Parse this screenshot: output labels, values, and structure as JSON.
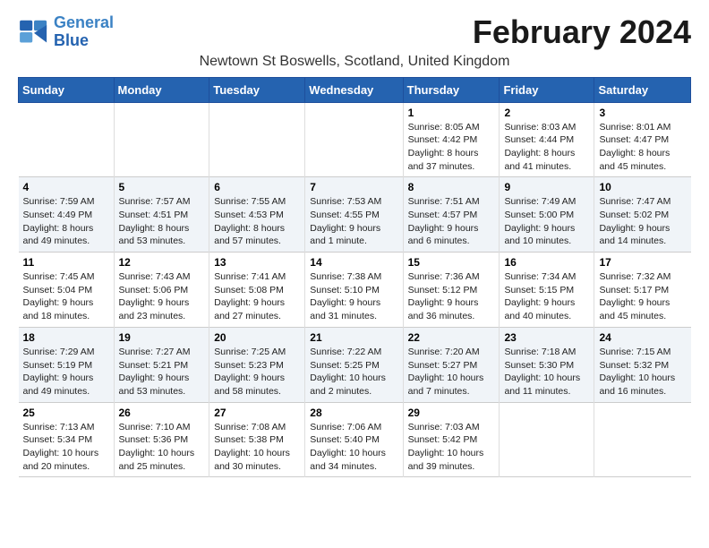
{
  "logo": {
    "line1": "General",
    "line2": "Blue"
  },
  "title": "February 2024",
  "location": "Newtown St Boswells, Scotland, United Kingdom",
  "days_of_week": [
    "Sunday",
    "Monday",
    "Tuesday",
    "Wednesday",
    "Thursday",
    "Friday",
    "Saturday"
  ],
  "weeks": [
    [
      {
        "day": "",
        "info": ""
      },
      {
        "day": "",
        "info": ""
      },
      {
        "day": "",
        "info": ""
      },
      {
        "day": "",
        "info": ""
      },
      {
        "day": "1",
        "info": "Sunrise: 8:05 AM\nSunset: 4:42 PM\nDaylight: 8 hours\nand 37 minutes."
      },
      {
        "day": "2",
        "info": "Sunrise: 8:03 AM\nSunset: 4:44 PM\nDaylight: 8 hours\nand 41 minutes."
      },
      {
        "day": "3",
        "info": "Sunrise: 8:01 AM\nSunset: 4:47 PM\nDaylight: 8 hours\nand 45 minutes."
      }
    ],
    [
      {
        "day": "4",
        "info": "Sunrise: 7:59 AM\nSunset: 4:49 PM\nDaylight: 8 hours\nand 49 minutes."
      },
      {
        "day": "5",
        "info": "Sunrise: 7:57 AM\nSunset: 4:51 PM\nDaylight: 8 hours\nand 53 minutes."
      },
      {
        "day": "6",
        "info": "Sunrise: 7:55 AM\nSunset: 4:53 PM\nDaylight: 8 hours\nand 57 minutes."
      },
      {
        "day": "7",
        "info": "Sunrise: 7:53 AM\nSunset: 4:55 PM\nDaylight: 9 hours\nand 1 minute."
      },
      {
        "day": "8",
        "info": "Sunrise: 7:51 AM\nSunset: 4:57 PM\nDaylight: 9 hours\nand 6 minutes."
      },
      {
        "day": "9",
        "info": "Sunrise: 7:49 AM\nSunset: 5:00 PM\nDaylight: 9 hours\nand 10 minutes."
      },
      {
        "day": "10",
        "info": "Sunrise: 7:47 AM\nSunset: 5:02 PM\nDaylight: 9 hours\nand 14 minutes."
      }
    ],
    [
      {
        "day": "11",
        "info": "Sunrise: 7:45 AM\nSunset: 5:04 PM\nDaylight: 9 hours\nand 18 minutes."
      },
      {
        "day": "12",
        "info": "Sunrise: 7:43 AM\nSunset: 5:06 PM\nDaylight: 9 hours\nand 23 minutes."
      },
      {
        "day": "13",
        "info": "Sunrise: 7:41 AM\nSunset: 5:08 PM\nDaylight: 9 hours\nand 27 minutes."
      },
      {
        "day": "14",
        "info": "Sunrise: 7:38 AM\nSunset: 5:10 PM\nDaylight: 9 hours\nand 31 minutes."
      },
      {
        "day": "15",
        "info": "Sunrise: 7:36 AM\nSunset: 5:12 PM\nDaylight: 9 hours\nand 36 minutes."
      },
      {
        "day": "16",
        "info": "Sunrise: 7:34 AM\nSunset: 5:15 PM\nDaylight: 9 hours\nand 40 minutes."
      },
      {
        "day": "17",
        "info": "Sunrise: 7:32 AM\nSunset: 5:17 PM\nDaylight: 9 hours\nand 45 minutes."
      }
    ],
    [
      {
        "day": "18",
        "info": "Sunrise: 7:29 AM\nSunset: 5:19 PM\nDaylight: 9 hours\nand 49 minutes."
      },
      {
        "day": "19",
        "info": "Sunrise: 7:27 AM\nSunset: 5:21 PM\nDaylight: 9 hours\nand 53 minutes."
      },
      {
        "day": "20",
        "info": "Sunrise: 7:25 AM\nSunset: 5:23 PM\nDaylight: 9 hours\nand 58 minutes."
      },
      {
        "day": "21",
        "info": "Sunrise: 7:22 AM\nSunset: 5:25 PM\nDaylight: 10 hours\nand 2 minutes."
      },
      {
        "day": "22",
        "info": "Sunrise: 7:20 AM\nSunset: 5:27 PM\nDaylight: 10 hours\nand 7 minutes."
      },
      {
        "day": "23",
        "info": "Sunrise: 7:18 AM\nSunset: 5:30 PM\nDaylight: 10 hours\nand 11 minutes."
      },
      {
        "day": "24",
        "info": "Sunrise: 7:15 AM\nSunset: 5:32 PM\nDaylight: 10 hours\nand 16 minutes."
      }
    ],
    [
      {
        "day": "25",
        "info": "Sunrise: 7:13 AM\nSunset: 5:34 PM\nDaylight: 10 hours\nand 20 minutes."
      },
      {
        "day": "26",
        "info": "Sunrise: 7:10 AM\nSunset: 5:36 PM\nDaylight: 10 hours\nand 25 minutes."
      },
      {
        "day": "27",
        "info": "Sunrise: 7:08 AM\nSunset: 5:38 PM\nDaylight: 10 hours\nand 30 minutes."
      },
      {
        "day": "28",
        "info": "Sunrise: 7:06 AM\nSunset: 5:40 PM\nDaylight: 10 hours\nand 34 minutes."
      },
      {
        "day": "29",
        "info": "Sunrise: 7:03 AM\nSunset: 5:42 PM\nDaylight: 10 hours\nand 39 minutes."
      },
      {
        "day": "",
        "info": ""
      },
      {
        "day": "",
        "info": ""
      }
    ]
  ]
}
